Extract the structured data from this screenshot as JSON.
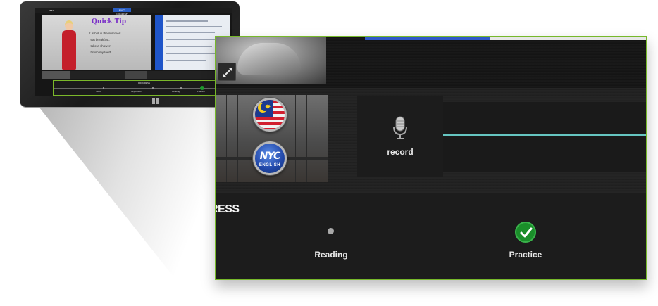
{
  "tablet": {
    "window_title": "NYC ENGLISH",
    "quick_tip": {
      "title": "Quick Tip",
      "lines": [
        "It is hot in the summer!",
        "I eat breakfast.",
        "I take a shower!",
        "I brush my teeth."
      ]
    },
    "progress": {
      "title": "PROGRESS",
      "steps": [
        "Video",
        "Key Words",
        "Reading",
        "Practice"
      ]
    }
  },
  "zoom": {
    "record_label": "record",
    "progress_title": "RESS",
    "steps": [
      {
        "label": "Reading",
        "status": "incomplete"
      },
      {
        "label": "Practice",
        "status": "complete"
      }
    ],
    "top_progress_fraction": 0.44,
    "flags": [
      {
        "icon": "malaysia-flag-icon"
      },
      {
        "icon": "nyc-english-logo-icon",
        "text_top": "NYC",
        "text_bottom": "ENGLISH"
      }
    ]
  },
  "colors": {
    "highlight_border": "#76b82a",
    "progress_blue": "#2f58c8",
    "check_green": "#1a8e2a",
    "waveform": "#66c5c1"
  }
}
